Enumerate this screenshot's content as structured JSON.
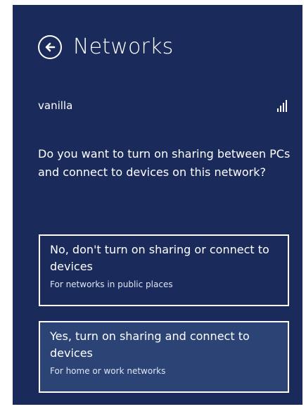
{
  "header": {
    "title": "Networks",
    "back_icon": "back-arrow-circle-icon"
  },
  "network": {
    "name": "vanilla",
    "signal_icon": "signal-strength-icon"
  },
  "prompt": {
    "question": "Do you want to turn on sharing between PCs and connect to devices on this network?"
  },
  "options": [
    {
      "title": "No, don't turn on sharing or connect to devices",
      "subtitle": "For networks in public places"
    },
    {
      "title": "Yes, turn on sharing and connect to devices",
      "subtitle": "For home or work networks"
    }
  ],
  "colors": {
    "panel_background": "#1a2a5b",
    "selected_option_background": "#2c4475",
    "text": "#ffffff"
  }
}
